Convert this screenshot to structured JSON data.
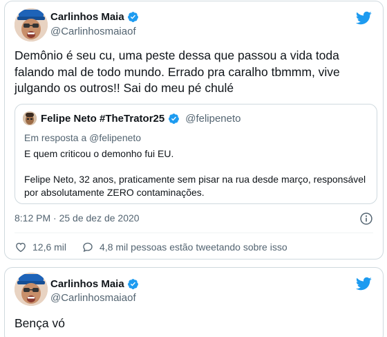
{
  "tweet1": {
    "name": "Carlinhos Maia",
    "handle": "@Carlinhosmaiaof",
    "text": "Demônio é seu cu, uma peste dessa que passou a vida toda falando mal de todo mundo. Errado pra caralho tbmmm, vive julgando os outros!! Sai do meu pé chulé",
    "quote": {
      "name": "Felipe Neto #TheTrator25",
      "handle": "@felipeneto",
      "reply_prefix": "Em resposta a",
      "reply_handle": "@felipeneto",
      "line1": "E quem criticou o demonho fui EU.",
      "line2": "Felipe Neto, 32 anos, praticamente sem pisar na rua desde março, responsável por absolutamente ZERO contaminações."
    },
    "timestamp": "8:12 PM · 25 de dez de 2020",
    "likes": "12,6 mil",
    "conversation": "4,8 mil pessoas estão tweetando sobre isso"
  },
  "tweet2": {
    "name": "Carlinhos Maia",
    "handle": "@Carlinhosmaiaof",
    "text": "Bença vó"
  },
  "colors": {
    "twitter_blue": "#1d9bf0",
    "secondary_text": "#536471",
    "border": "#cfd9de"
  },
  "icons": {
    "brand": "twitter-bird-icon",
    "verified": "verified-badge-icon",
    "info": "info-icon",
    "like": "heart-icon",
    "reply": "speech-bubble-icon"
  }
}
